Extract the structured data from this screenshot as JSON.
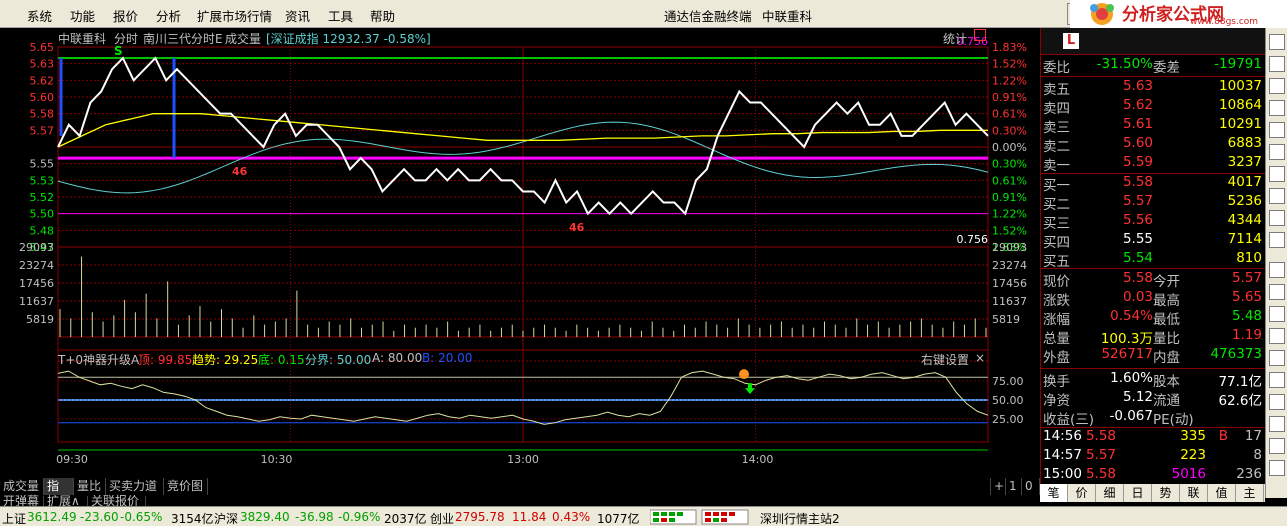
{
  "menu": {
    "items": [
      "系统",
      "功能",
      "报价",
      "分析",
      "扩展市场行情",
      "资讯",
      "工具",
      "帮助"
    ],
    "window_title": "通达信金融终端",
    "stock_name": "中联重科",
    "window_button": "行",
    "logo_text": "分析家公式网",
    "logo_url": "www.88gs.com"
  },
  "chart_header": {
    "stock": "中联重科",
    "mode": "分时",
    "indicator": "南川三代分时E",
    "volume_label": "成交量",
    "index_label": "[深证成指 12932.37 -0.58%]",
    "stat_label": "统计",
    "price_axis": [
      "5.65",
      "5.63",
      "5.62",
      "5.60",
      "5.58",
      "5.57",
      "5.55",
      "5.53",
      "5.52",
      "5.50",
      "5.48",
      "5.47"
    ],
    "pct_axis": [
      "1.83%",
      "1.52%",
      "1.22%",
      "0.91%",
      "0.61%",
      "0.30%",
      "0.00%",
      "0.30%",
      "0.61%",
      "0.91%",
      "1.22%",
      "1.52%",
      "1.83%"
    ],
    "ratio_top": "0.756",
    "ratio_bottom": "0.756",
    "vol_axis_left": [
      "29093",
      "23274",
      "17456",
      "11637",
      "5819"
    ],
    "vol_axis_right": [
      "29093",
      "23274",
      "17456",
      "11637",
      "5819"
    ],
    "markers": [
      "S",
      "46",
      "46"
    ]
  },
  "indicator_panel": {
    "name": "T+0神器升级A",
    "top_label": "顶: 99.85",
    "trend_label": "趋势: 29.25",
    "bottom_label": "底: 0.15",
    "boundary_label": "分界: 50.00",
    "a_label": "A: 80.00",
    "b_label": "B: 20.00",
    "settings": "右键设置",
    "close": "×",
    "axis": [
      "75.00",
      "50.00",
      "25.00"
    ]
  },
  "time_axis": [
    "09:30",
    "10:30",
    "13:00",
    "14:00"
  ],
  "bottom_tabs1": [
    "成交量",
    "指标",
    "量比",
    "买卖力道",
    "竞价图"
  ],
  "bottom_tabs1_controls": [
    "+",
    "1",
    "0"
  ],
  "bottom_tabs2": [
    "开弹幕",
    "扩展∧",
    "关联报价"
  ],
  "quote": {
    "head_left": "L",
    "wei_bi": {
      "label": "委比",
      "value": "-31.50%",
      "label2": "委差",
      "value2": "-19791"
    },
    "sells": [
      {
        "label": "卖五",
        "price": "5.63",
        "vol": "10037"
      },
      {
        "label": "卖四",
        "price": "5.62",
        "vol": "10864"
      },
      {
        "label": "卖三",
        "price": "5.61",
        "vol": "10291"
      },
      {
        "label": "卖二",
        "price": "5.60",
        "vol": "6883"
      },
      {
        "label": "卖一",
        "price": "5.59",
        "vol": "3237"
      }
    ],
    "buys": [
      {
        "label": "买一",
        "price": "5.58",
        "vol": "4017"
      },
      {
        "label": "买二",
        "price": "5.57",
        "vol": "5236"
      },
      {
        "label": "买三",
        "price": "5.56",
        "vol": "4344"
      },
      {
        "label": "买四",
        "price": "5.55",
        "vol": "7114"
      },
      {
        "label": "买五",
        "price": "5.54",
        "vol": "810"
      }
    ],
    "stats": [
      {
        "l1": "现价",
        "v1": "5.58",
        "l2": "今开",
        "v2": "5.57"
      },
      {
        "l1": "涨跌",
        "v1": "0.03",
        "l2": "最高",
        "v2": "5.65"
      },
      {
        "l1": "涨幅",
        "v1": "0.54%",
        "l2": "最低",
        "v2": "5.48"
      },
      {
        "l1": "总量",
        "v1": "100.3万",
        "l2": "量比",
        "v2": "1.19"
      },
      {
        "l1": "外盘",
        "v1": "526717",
        "l2": "内盘",
        "v2": "476373"
      }
    ],
    "fund": [
      {
        "l1": "换手",
        "v1": "1.60%",
        "l2": "股本",
        "v2": "77.1亿"
      },
      {
        "l1": "净资",
        "v1": "5.12",
        "l2": "流通",
        "v2": "62.6亿"
      },
      {
        "l1": "收益(三)",
        "v1": "-0.067",
        "l2": "PE(动)",
        "v2": ""
      }
    ],
    "ticks": [
      {
        "time": "14:56",
        "price": "5.58",
        "vol": "335",
        "flag": "B",
        "n": "17"
      },
      {
        "time": "14:57",
        "price": "5.57",
        "vol": "223",
        "flag": "",
        "n": "8"
      },
      {
        "time": "15:00",
        "price": "5.58",
        "vol": "5016",
        "flag": "",
        "n": "236"
      }
    ],
    "tabs": [
      "笔",
      "价",
      "细",
      "日",
      "势",
      "联",
      "值",
      "主"
    ]
  },
  "status": {
    "sh_label": "上证",
    "sh_value": "3612.49",
    "sh_change": "-23.60",
    "sh_pct": "-0.65%",
    "sh_amount": "3154亿",
    "sz_label": "沪深",
    "sz_value": "3829.40",
    "sz_change": "-36.98",
    "sz_pct": "-0.96%",
    "sz_amount": "2037亿",
    "cy_label": "创业",
    "cy_value": "2795.78",
    "cy_change": "11.84",
    "cy_pct": "0.43%",
    "cy_amount": "1077亿",
    "server": "深圳行情主站2"
  },
  "colors": {
    "up": "#ff3232",
    "down": "#00e600",
    "price_line": "#ffffff",
    "avg_line": "#ffff00",
    "cyan_line": "#5fd0d0",
    "magenta": "#ff00ff",
    "grid": "#8b0000",
    "blue": "#1e90ff"
  },
  "chart_data": {
    "type": "line",
    "x_range": [
      "09:30",
      "15:00"
    ],
    "time_ticks": [
      "09:30",
      "10:30",
      "13:00",
      "14:00"
    ],
    "price": {
      "name": "分时",
      "ylim": [
        5.47,
        5.65
      ],
      "prev_close": 5.55,
      "values": [
        5.56,
        5.58,
        5.57,
        5.6,
        5.61,
        5.63,
        5.64,
        5.62,
        5.63,
        5.64,
        5.62,
        5.63,
        5.62,
        5.61,
        5.6,
        5.59,
        5.59,
        5.58,
        5.57,
        5.56,
        5.58,
        5.59,
        5.57,
        5.58,
        5.58,
        5.57,
        5.56,
        5.54,
        5.55,
        5.54,
        5.52,
        5.53,
        5.54,
        5.53,
        5.53,
        5.54,
        5.53,
        5.54,
        5.53,
        5.53,
        5.54,
        5.53,
        5.53,
        5.52,
        5.52,
        5.51,
        5.53,
        5.51,
        5.52,
        5.5,
        5.51,
        5.5,
        5.51,
        5.5,
        5.51,
        5.52,
        5.51,
        5.51,
        5.5,
        5.53,
        5.54,
        5.57,
        5.59,
        5.61,
        5.6,
        5.6,
        5.59,
        5.58,
        5.57,
        5.56,
        5.58,
        5.59,
        5.6,
        5.59,
        5.6,
        5.58,
        5.58,
        5.59,
        5.57,
        5.57,
        5.58,
        5.59,
        5.6,
        5.58,
        5.59,
        5.58,
        5.57
      ]
    },
    "average": {
      "name": "均价",
      "values": [
        5.56,
        5.57,
        5.58,
        5.585,
        5.59,
        5.59,
        5.59,
        5.588,
        5.586,
        5.584,
        5.582,
        5.58,
        5.578,
        5.576,
        5.574,
        5.572,
        5.57,
        5.568,
        5.566,
        5.566,
        5.566,
        5.566,
        5.567,
        5.568,
        5.568,
        5.568,
        5.569,
        5.57,
        5.57,
        5.571,
        5.572,
        5.572,
        5.573,
        5.573,
        5.573,
        5.574,
        5.574,
        5.575,
        5.575,
        5.575
      ]
    },
    "oscillator": {
      "name": "T+0神器升级A",
      "ylim": [
        0,
        100
      ],
      "a_level": 80,
      "b_level": 20,
      "boundary": 50,
      "values": [
        85,
        88,
        80,
        75,
        70,
        72,
        68,
        65,
        70,
        66,
        60,
        58,
        55,
        50,
        40,
        35,
        30,
        28,
        25,
        22,
        24,
        28,
        26,
        25,
        30,
        28,
        26,
        24,
        22,
        25,
        28,
        26,
        24,
        22,
        26,
        30,
        32,
        28,
        26,
        30,
        28,
        26,
        28,
        30,
        25,
        22,
        18,
        20,
        24,
        26,
        28,
        30,
        34,
        30,
        28,
        32,
        30,
        35,
        55,
        80,
        86,
        88,
        84,
        80,
        78,
        72,
        70,
        76,
        80,
        82,
        78,
        76,
        80,
        84,
        82,
        78,
        80,
        84,
        86,
        82,
        78,
        80,
        84,
        86,
        80,
        60,
        45,
        35,
        30
      ]
    },
    "volume": {
      "name": "成交量",
      "ylim": [
        0,
        29093
      ],
      "values": [
        9000,
        6000,
        26000,
        8000,
        5000,
        7000,
        12000,
        8000,
        14000,
        6000,
        18000,
        4000,
        7000,
        10000,
        5000,
        9000,
        6000,
        3000,
        7000,
        4000,
        5000,
        6000,
        15000,
        4000,
        3000,
        5000,
        4000,
        6000,
        3000,
        4000,
        5000,
        2000,
        4000,
        3000,
        4000,
        3000,
        5000,
        2000,
        3000,
        4000,
        2000,
        3000,
        4000,
        2000,
        3000,
        4000,
        3000,
        2000,
        4000,
        3000,
        2000,
        3000,
        4000,
        3000,
        2000,
        5000,
        3000,
        2000,
        4000,
        3000,
        5000,
        4000,
        3000,
        6000,
        4000,
        3000,
        4000,
        5000,
        3000,
        4000,
        3000,
        5000,
        4000,
        3000,
        6000,
        4000,
        5000,
        3000,
        4000,
        5000,
        6000,
        4000,
        3000,
        5000,
        4000,
        6000,
        3000
      ]
    }
  }
}
